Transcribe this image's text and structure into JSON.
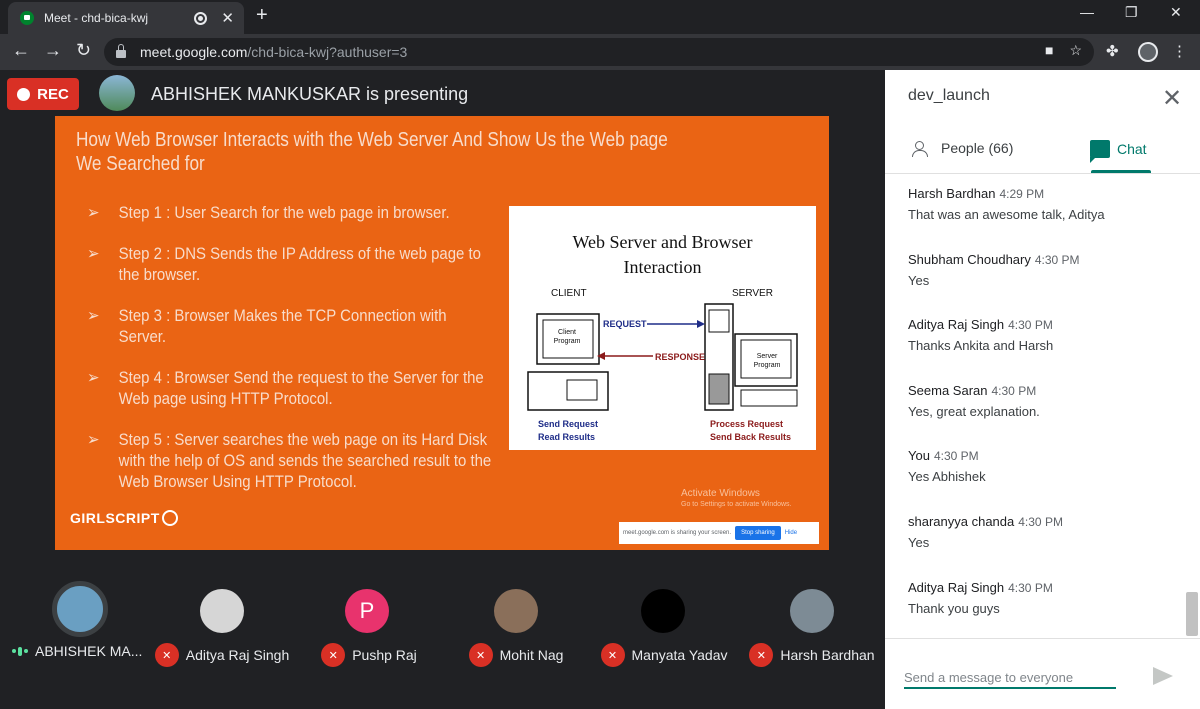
{
  "browser": {
    "tab_title": "Meet - chd-bica-kwj",
    "url_host": "meet.google.com",
    "url_path": "/chd-bica-kwj?authuser=3"
  },
  "meet": {
    "rec_label": "REC",
    "presenting_text": "ABHISHEK MANKUSKAR is presenting"
  },
  "slide": {
    "title": "How Web Browser Interacts with the Web Server And Show Us the Web page We Searched for",
    "bullet": "➢",
    "steps": [
      "Step 1 : User Search for the web page in browser.",
      "Step 2 : DNS Sends the IP Address of the web page to the browser.",
      "Step 3 : Browser Makes the TCP Connection with Server.",
      "Step 4 : Browser Send the request to the Server for the Web page using HTTP Protocol.",
      "Step 5 : Server searches the web page on its Hard Disk with the help of OS and sends the searched result to the Web Browser Using HTTP Protocol."
    ],
    "diagram": {
      "title_line1": "Web Server and Browser",
      "title_line2": "Interaction",
      "client_label": "CLIENT",
      "server_label": "SERVER",
      "request_label": "REQUEST",
      "response_label": "RESPONSE",
      "client_program": "Client Program",
      "server_program": "Server Program",
      "client_caption_1": "Send Request",
      "client_caption_2": "Read Results",
      "server_caption_1": "Process Request",
      "server_caption_2": "Send Back Results"
    },
    "logo": "GIRLSCRIPT",
    "watermark_1": "Activate Windows",
    "watermark_2": "Go to Settings to activate Windows.",
    "share_notice": "meet.google.com is sharing your screen.",
    "stop_sharing": "Stop sharing",
    "hide": "Hide"
  },
  "participants": [
    {
      "name": "ABHISHEK MA...",
      "state": "speaking",
      "avatar_color": "#6a9fc2"
    },
    {
      "name": "Aditya Raj Singh",
      "state": "muted",
      "avatar_color": "#d6d6d6"
    },
    {
      "name": "Pushp Raj",
      "state": "muted",
      "avatar_letter": "P",
      "avatar_color": "#e8336d"
    },
    {
      "name": "Mohit Nag",
      "state": "muted",
      "avatar_color": "#8a6f5a"
    },
    {
      "name": "Manyata Yadav",
      "state": "muted",
      "avatar_color": "#000000"
    },
    {
      "name": "Harsh Bardhan",
      "state": "muted",
      "avatar_color": "#7d8b95"
    }
  ],
  "panel": {
    "meeting_name": "dev_launch",
    "people_tab": "People (66)",
    "chat_tab": "Chat",
    "messages": [
      {
        "sender": "Harsh Bardhan",
        "time": "4:29 PM",
        "text": "That was an awesome talk, Aditya"
      },
      {
        "sender": "Shubham Choudhary",
        "time": "4:30 PM",
        "text": "Yes"
      },
      {
        "sender": "Aditya Raj Singh",
        "time": "4:30 PM",
        "text": "Thanks Ankita and Harsh"
      },
      {
        "sender": "Seema Saran",
        "time": "4:30 PM",
        "text": "Yes, great explanation."
      },
      {
        "sender": "You",
        "time": "4:30 PM",
        "text": "Yes Abhishek"
      },
      {
        "sender": "sharanyya chanda",
        "time": "4:30 PM",
        "text": "Yes"
      },
      {
        "sender": "Aditya Raj Singh",
        "time": "4:30 PM",
        "text": "Thank you guys"
      }
    ],
    "compose_placeholder": "Send a message to everyone"
  },
  "colors": {
    "rec": "#d93025",
    "slide_bg": "#ea6414",
    "meet_teal": "#00796b"
  }
}
